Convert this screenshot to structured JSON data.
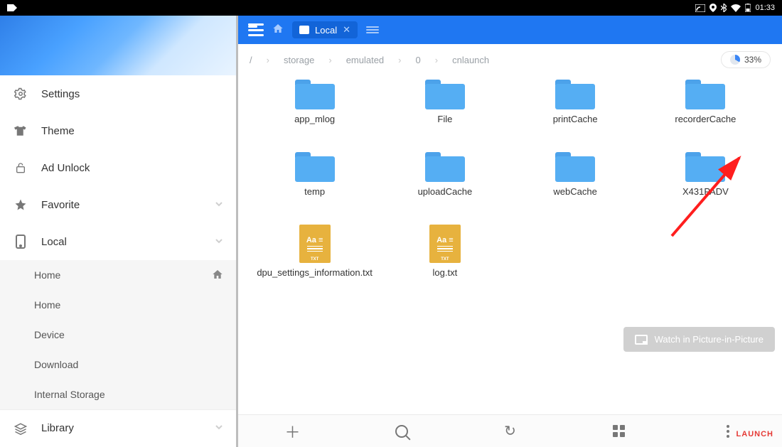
{
  "statusbar": {
    "time": "01:33"
  },
  "sidebar": {
    "items": [
      {
        "label": "Settings"
      },
      {
        "label": "Theme"
      },
      {
        "label": "Ad Unlock"
      },
      {
        "label": "Favorite"
      },
      {
        "label": "Local"
      },
      {
        "label": "Library"
      }
    ],
    "local_children": [
      {
        "label": "Home"
      },
      {
        "label": "Home"
      },
      {
        "label": "Device"
      },
      {
        "label": "Download"
      },
      {
        "label": "Internal Storage"
      }
    ]
  },
  "tab": {
    "label": "Local"
  },
  "breadcrumbs": [
    "/",
    "storage",
    "emulated",
    "0",
    "cnlaunch"
  ],
  "storage_percent": "33%",
  "files": {
    "r1": [
      {
        "name": "app_mlog",
        "type": "folder"
      },
      {
        "name": "File",
        "type": "folder"
      },
      {
        "name": "printCache",
        "type": "folder"
      },
      {
        "name": "recorderCache",
        "type": "folder"
      }
    ],
    "r2": [
      {
        "name": "temp",
        "type": "folder"
      },
      {
        "name": "uploadCache",
        "type": "folder"
      },
      {
        "name": "webCache",
        "type": "folder"
      },
      {
        "name": "X431PADV",
        "type": "folder"
      }
    ],
    "r3": [
      {
        "name": "dpu_settings_information.txt",
        "type": "txt"
      },
      {
        "name": "log.txt",
        "type": "txt"
      }
    ]
  },
  "pip": {
    "label": "Watch in Picture-in-Picture"
  },
  "brand": "LAUNCH"
}
